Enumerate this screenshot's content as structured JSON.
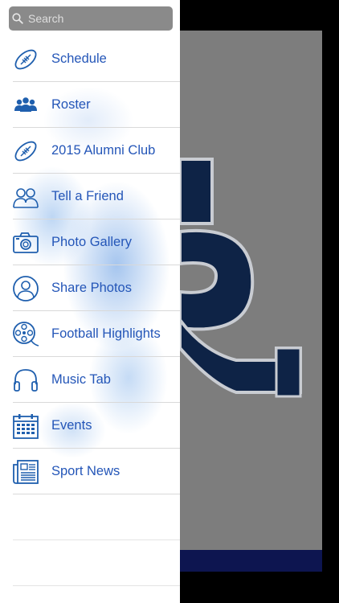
{
  "search": {
    "placeholder": "Search",
    "icon": "search-icon"
  },
  "menu": {
    "items": [
      {
        "label": "Schedule",
        "icon": "football-icon"
      },
      {
        "label": "Roster",
        "icon": "team-icon"
      },
      {
        "label": "2015 Alumni Club",
        "icon": "football-icon"
      },
      {
        "label": "Tell a Friend",
        "icon": "friends-icon"
      },
      {
        "label": "Photo Gallery",
        "icon": "camera-icon"
      },
      {
        "label": "Share Photos",
        "icon": "user-profile-icon"
      },
      {
        "label": "Football Highlights",
        "icon": "film-reel-icon"
      },
      {
        "label": "Music Tab",
        "icon": "headphones-icon"
      },
      {
        "label": "Events",
        "icon": "calendar-icon"
      },
      {
        "label": "Sport News",
        "icon": "newspaper-icon"
      }
    ]
  },
  "colors": {
    "accent": "#2456b8",
    "icon": "#1f5fae",
    "logo_navy": "#0e2346",
    "background_gray": "#7d7d7d",
    "footer_bar": "#0d1550"
  }
}
